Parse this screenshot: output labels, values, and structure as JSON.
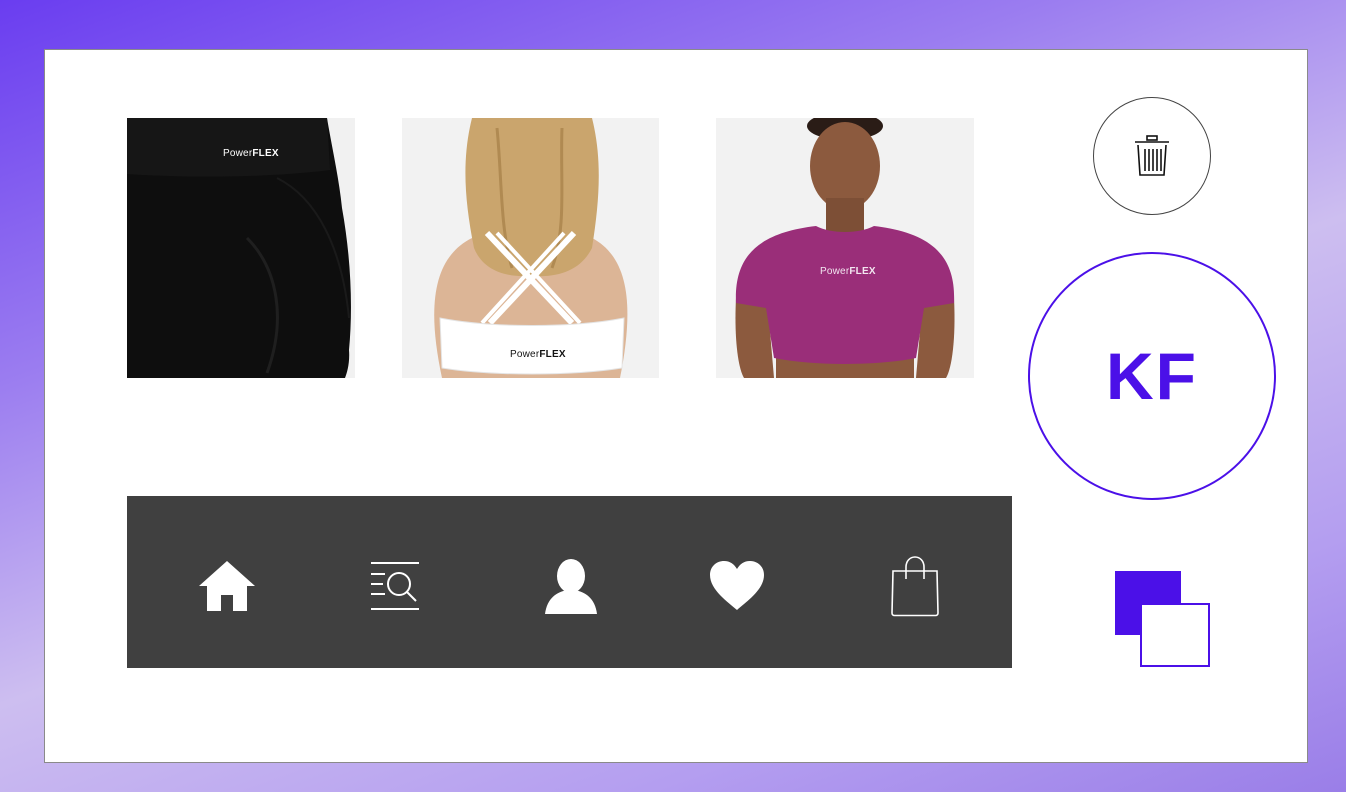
{
  "products": [
    {
      "name": "black-shorts",
      "brand_light": "Power",
      "brand_bold": "FLEX",
      "color": "#0b0b0b"
    },
    {
      "name": "white-sports-bra",
      "brand_light": "Power",
      "brand_bold": "FLEX",
      "color": "#f4f4f4"
    },
    {
      "name": "magenta-crop-top",
      "brand_light": "Power",
      "brand_bold": "FLEX",
      "color": "#9a2e79"
    }
  ],
  "avatar": {
    "initials": "KF"
  },
  "nav": {
    "items": [
      "home-icon",
      "search-list-icon",
      "profile-icon",
      "heart-icon",
      "shopping-bag-icon"
    ]
  },
  "colors": {
    "accent": "#4b10e8",
    "navbar": "#404040"
  }
}
